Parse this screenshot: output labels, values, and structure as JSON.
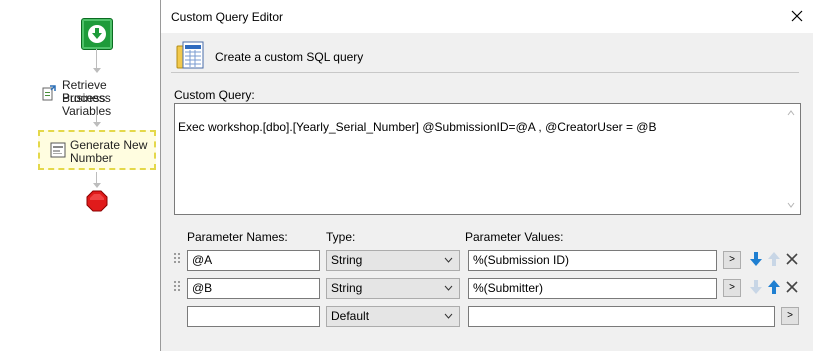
{
  "workflow": {
    "nodes": [
      {
        "label_line1": "Retrieve Business",
        "label_line2": "Process Variables"
      },
      {
        "label_line1": "Generate New",
        "label_line2": "Number"
      }
    ]
  },
  "dialog": {
    "title": "Custom Query Editor",
    "header_text": "Create a custom SQL query",
    "query_label": "Custom Query:",
    "query_text": "Exec workshop.[dbo].[Yearly_Serial_Number] @SubmissionID=@A , @CreatorUser = @B",
    "columns": {
      "names": "Parameter Names:",
      "type": "Type:",
      "values": "Parameter Values:"
    },
    "parameters": [
      {
        "name": "@A",
        "type": "String",
        "value": "%(Submission ID)"
      },
      {
        "name": "@B",
        "type": "String",
        "value": "%(Submitter)"
      },
      {
        "name": "",
        "type": "Default",
        "value": ""
      }
    ],
    "browse_label": ">"
  },
  "colors": {
    "start": "#1e9b3a",
    "stop": "#e01b1b",
    "selection": "#e4d84a",
    "arrow_blue": "#1f7fd1"
  }
}
